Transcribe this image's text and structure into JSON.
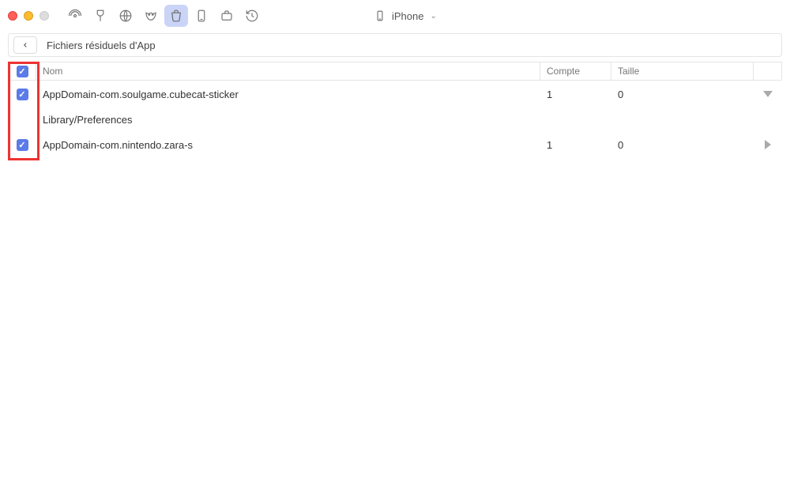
{
  "device": {
    "label": "iPhone"
  },
  "header": {
    "title": "Fichiers résiduels d'App"
  },
  "columns": {
    "name": "Nom",
    "count": "Compte",
    "size": "Taille"
  },
  "rows": [
    {
      "name": "AppDomain-com.soulgame.cubecat-sticker",
      "count": "1",
      "size": "0",
      "expanded": true,
      "checked": true,
      "children": [
        {
          "name": "Library/Preferences"
        }
      ]
    },
    {
      "name": "AppDomain-com.nintendo.zara-s",
      "count": "1",
      "size": "0",
      "expanded": false,
      "checked": true
    }
  ],
  "master_checked": true
}
